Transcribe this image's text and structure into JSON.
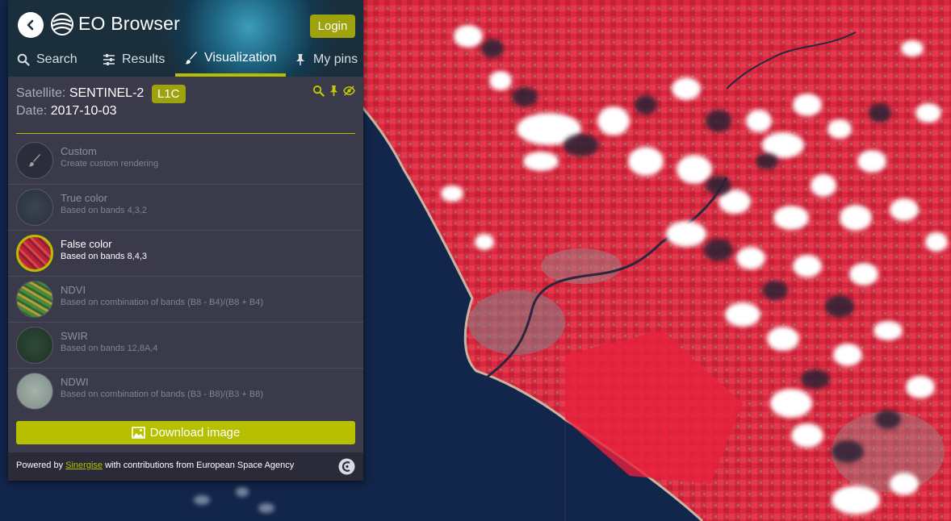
{
  "app": {
    "title": "EO Browser",
    "login_label": "Login"
  },
  "tabs": [
    {
      "label": "Search",
      "icon": "search-icon",
      "active": false
    },
    {
      "label": "Results",
      "icon": "sliders-icon",
      "active": false
    },
    {
      "label": "Visualization",
      "icon": "brush-icon",
      "active": true
    },
    {
      "label": "My pins",
      "icon": "pin-icon",
      "active": false
    }
  ],
  "info": {
    "satellite_label": "Satellite:",
    "satellite_value": "SENTINEL-2",
    "level_badge": "L1C",
    "date_label": "Date:",
    "date_value": "2017-10-03"
  },
  "visualizations": [
    {
      "name": "Custom",
      "desc": "Create custom rendering",
      "active": false
    },
    {
      "name": "True color",
      "desc": "Based on bands 4,3,2",
      "active": false
    },
    {
      "name": "False color",
      "desc": "Based on bands 8,4,3",
      "active": true
    },
    {
      "name": "NDVI",
      "desc": "Based on combination of bands (B8 - B4)/(B8 + B4)",
      "active": false
    },
    {
      "name": "SWIR",
      "desc": "Based on bands 12,8A,4",
      "active": false
    },
    {
      "name": "NDWI",
      "desc": "Based on combination of bands (B3 - B8)/(B3 + B8)",
      "active": false
    }
  ],
  "download_label": "Download image",
  "footer": {
    "prefix": "Powered by ",
    "link": "Sinergise",
    "suffix": " with contributions from European Space Agency"
  },
  "colors": {
    "accent": "#b6bf00",
    "panel_bg": "#3a3a4a",
    "sea": "#12254a",
    "land": "#d8283e"
  }
}
